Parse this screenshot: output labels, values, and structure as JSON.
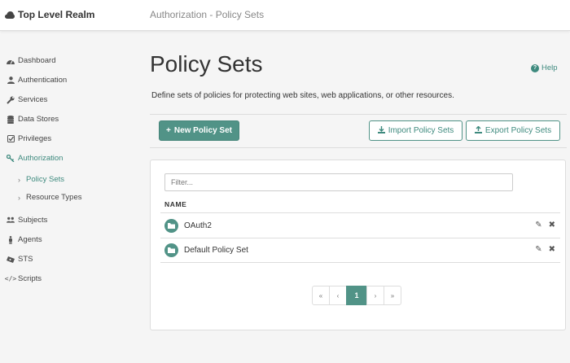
{
  "header": {
    "realm": "Top Level Realm",
    "breadcrumb": "Authorization - Policy Sets"
  },
  "sidebar": {
    "items": [
      {
        "label": "Dashboard",
        "icon": "dashboard-icon"
      },
      {
        "label": "Authentication",
        "icon": "user-icon"
      },
      {
        "label": "Services",
        "icon": "wrench-icon"
      },
      {
        "label": "Data Stores",
        "icon": "database-icon"
      },
      {
        "label": "Privileges",
        "icon": "checkbox-icon"
      },
      {
        "label": "Authorization",
        "icon": "key-icon",
        "active": true
      },
      {
        "label": "Subjects",
        "icon": "users-icon"
      },
      {
        "label": "Agents",
        "icon": "male-icon"
      },
      {
        "label": "STS",
        "icon": "ticket-icon"
      },
      {
        "label": "Scripts",
        "icon": "code-icon"
      }
    ],
    "subitems": [
      {
        "label": "Policy Sets",
        "active": true
      },
      {
        "label": "Resource Types"
      }
    ]
  },
  "main": {
    "title": "Policy Sets",
    "help": "Help",
    "description": "Define sets of policies for protecting web sites, web applications, or other resources.",
    "new_button": "New Policy Set",
    "import_button": "Import Policy Sets",
    "export_button": "Export Policy Sets"
  },
  "table": {
    "filter_placeholder": "Filter...",
    "column": "NAME",
    "rows": [
      {
        "name": "OAuth2"
      },
      {
        "name": "Default Policy Set"
      }
    ]
  },
  "pagination": {
    "first": "«",
    "prev": "‹",
    "current": "1",
    "next": "›",
    "last": "»"
  },
  "colors": {
    "accent": "#519387",
    "active_text": "#3e8a7e"
  }
}
